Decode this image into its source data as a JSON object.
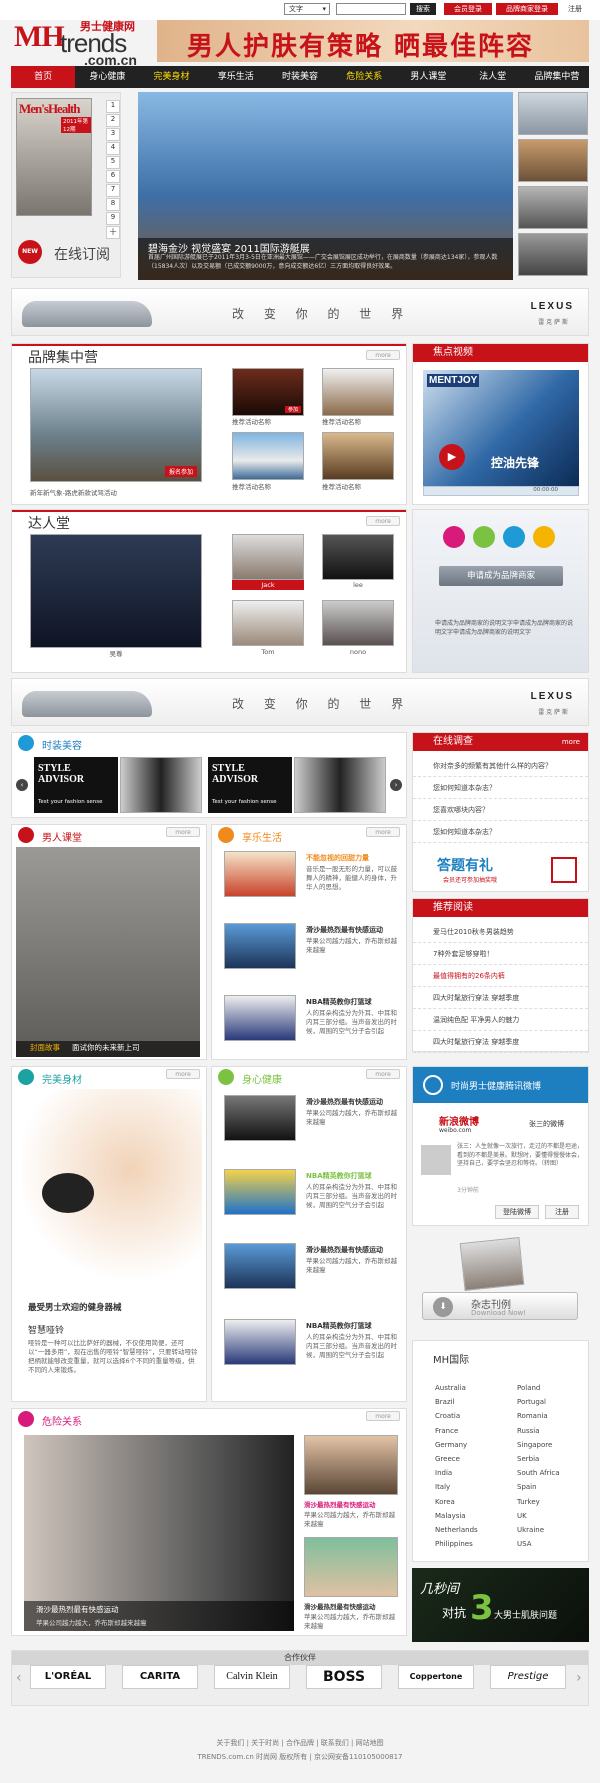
{
  "topbar": {
    "select": "文字",
    "search": "搜索",
    "login": "会员登录",
    "brand_login": "品牌商家登录",
    "register": "注册"
  },
  "logo": {
    "mh": "MH",
    "trends": "trends",
    "cn": ".com.cn",
    "site": "男士健康网"
  },
  "banner": {
    "text": "男人护肤有策略 晒最佳阵容"
  },
  "nav": [
    "首页",
    "身心健康",
    "完美身材",
    "享乐生活",
    "时装美容",
    "危险关系",
    "男人课堂",
    "法人堂",
    "品牌集中营"
  ],
  "subscribe": {
    "label": "在线订阅",
    "new": "NEW",
    "mag": "Men'sHealth",
    "issue": "2011年第12期",
    "pages": [
      "1",
      "2",
      "3",
      "4",
      "5",
      "6",
      "7",
      "8",
      "9",
      "十"
    ]
  },
  "hero": {
    "title": "碧海金沙 视觉盛宴 2011国际游艇展",
    "desc": "首届广州国际游艇展已于2011年3月3-5日在亚洲最大展馆——广交会展馆展区成功举行，在展商数量（参展商达134家），参观人数（15834人次）以及交易额（已成交额9000万，意向成交额达6亿）三方面均取得良好效果。"
  },
  "lexus": {
    "slogan": "改 变 你 的 世 界",
    "brand": "LEXUS",
    "sub": "雷 克 萨 斯"
  },
  "brandcamp": {
    "title": "品牌集中营",
    "more": "more",
    "main_caption": "新年新气象-路虎新款试驾活动",
    "signup": "报名参加",
    "items": [
      "推荐活动名称",
      "推荐活动名称",
      "推荐活动名称",
      "推荐活动名称"
    ],
    "join": "参加"
  },
  "video": {
    "title": "焦点视频",
    "ad1": "MENTJOY",
    "ad2": "控油先锋",
    "time": "00:00:00"
  },
  "darentang": {
    "title": "达人堂",
    "more": "more",
    "main": "吴尊",
    "people": [
      "Jack",
      "lee",
      "Tom",
      "nono"
    ]
  },
  "applybrand": {
    "button": "申请成为品牌商家",
    "desc": "申请成为品牌商家的说明文字申请成为品牌商家的说明文字申请成为品牌商家的说明文字"
  },
  "fashion": {
    "title": "时装美容",
    "card": "STYLE ADVISOR",
    "sub": "Test your fashion sense"
  },
  "survey": {
    "title": "在线调查",
    "more": "more",
    "items": [
      "你对奈多的频繁有其他什么样的内容？",
      "您如何知道本杂志？",
      "您喜欢哪块内容？",
      "您如何知道本杂志？"
    ],
    "gift": "答题有礼",
    "gift_sub": "会员还可参加抽奖哦"
  },
  "classroom": {
    "title": "男人课堂",
    "more": "more",
    "tag": "封面故事",
    "caption": "面试你的未来新上司"
  },
  "leisure": {
    "title": "享乐生活",
    "more": "more",
    "items": [
      {
        "t": "不能忽视的回甜力量",
        "d": "音乐是一股无形的力量，可以鼓舞人的精神，能健人的身体，升华人的思想。"
      },
      {
        "t": "滑沙最热烈最有快感运动",
        "d": "苹果公司越力越大，乔布斯却越来越瘦"
      },
      {
        "t": "NBA精英教你打篮球",
        "d": "人的耳朵构造分为外耳、中耳和内耳三部分组。当声音发出的时候，周围的空气分子会引起"
      }
    ]
  },
  "reading": {
    "title": "推荐阅读",
    "items": [
      "爱马仕2010秋冬男装趋势",
      "7种外套足够穿啦！",
      "最值得拥有的26条内裤",
      "四大时髦旅行穿法 穿越季度",
      "温润纯色配 平净男人的魅力",
      "四大时髦旅行穿法 穿越季度"
    ]
  },
  "bodyfit": {
    "title": "完美身材",
    "more": "more",
    "headline": "最受男士欢迎的健身器械",
    "sub": "智慧哑铃",
    "desc": "哑铃是一种可以比比萨好的器械，不仅使用简便，还可以“一器多用”，现在出售的哑铃“智慧哑铃”，只要转动哑铃把柄就能够改变重量，就可以选择6个不同的重量等级，供不同的人来锻炼。"
  },
  "health": {
    "title": "身心健康",
    "more": "more",
    "items": [
      {
        "t": "滑沙最热烈最有快感运动",
        "d": "苹果公司越力越大，乔布斯却越来越瘦"
      },
      {
        "t": "NBA精英教你打篮球",
        "d": "人的耳朵构造分为外耳、中耳和内耳三部分组。当声音发出的时候，周围的空气分子会引起"
      },
      {
        "t": "滑沙最热烈最有快感运动",
        "d": "苹果公司越力越大，乔布斯却越来越瘦"
      },
      {
        "t": "NBA精英教你打篮球",
        "d": "人的耳朵构造分为外耳、中耳和内耳三部分组。当声音发出的时候，周围的空气分子会引起"
      }
    ]
  },
  "weibo": {
    "title": "时尚男士健康腾讯微博",
    "brand": "新浪微博",
    "domain": "weibo.com",
    "user": "张三的微博",
    "post": "张三：人生就像一次旅行，走过的不都是坦途，看到的不都是美景。默想时，要懂得慢慢体会，坚持自己，要学会坚忍和等待。（转图）",
    "time": "3分钟前",
    "login": "登陆微博",
    "reg": "注册"
  },
  "magazine": {
    "label": "杂志刊例",
    "sub": "Download Now!"
  },
  "danger": {
    "title": "危险关系",
    "more": "more",
    "caption": "滑沙最热烈最有快感运动",
    "caption_sub": "苹果公司越力越大，乔布斯却越来越瘦",
    "items": [
      {
        "t": "滑沙最热烈最有快感运动",
        "d": "苹果公司越力越大，乔布斯却越来越瘦"
      },
      {
        "t": "滑沙最热烈最有快感运动",
        "d": "苹果公司越力越大，乔布斯却越来越瘦"
      }
    ]
  },
  "mhintl": {
    "title": "MH国际",
    "left": [
      "Australia",
      "Brazil",
      "Croatia",
      "France",
      "Germany",
      "Greece",
      "India",
      "Italy",
      "Korea",
      "Malaysia",
      "Netherlands",
      "Philippines"
    ],
    "right": [
      "Poland",
      "Portugal",
      "Romania",
      "Russia",
      "Singapore",
      "Serbia",
      "South Africa",
      "Spain",
      "Turkey",
      "UK",
      "Ukraine",
      "USA"
    ]
  },
  "promo": {
    "text1": "几秒间",
    "text2": "对抗",
    "num": "3",
    "text3": "大男士肌肤问题"
  },
  "partners": {
    "title": "合作伙伴",
    "brands": [
      "L'ORÉAL",
      "CARITA",
      "Calvin Klein",
      "BOSS",
      "Coppertone",
      "Prestige"
    ]
  },
  "footer": {
    "links": "关于我们 | 关于时尚 | 合作品牌 | 联系我们 | 网站地图",
    "copy": "TRENDS.com.cn 时尚网 版权所有 | 京公网安备110105000817"
  }
}
